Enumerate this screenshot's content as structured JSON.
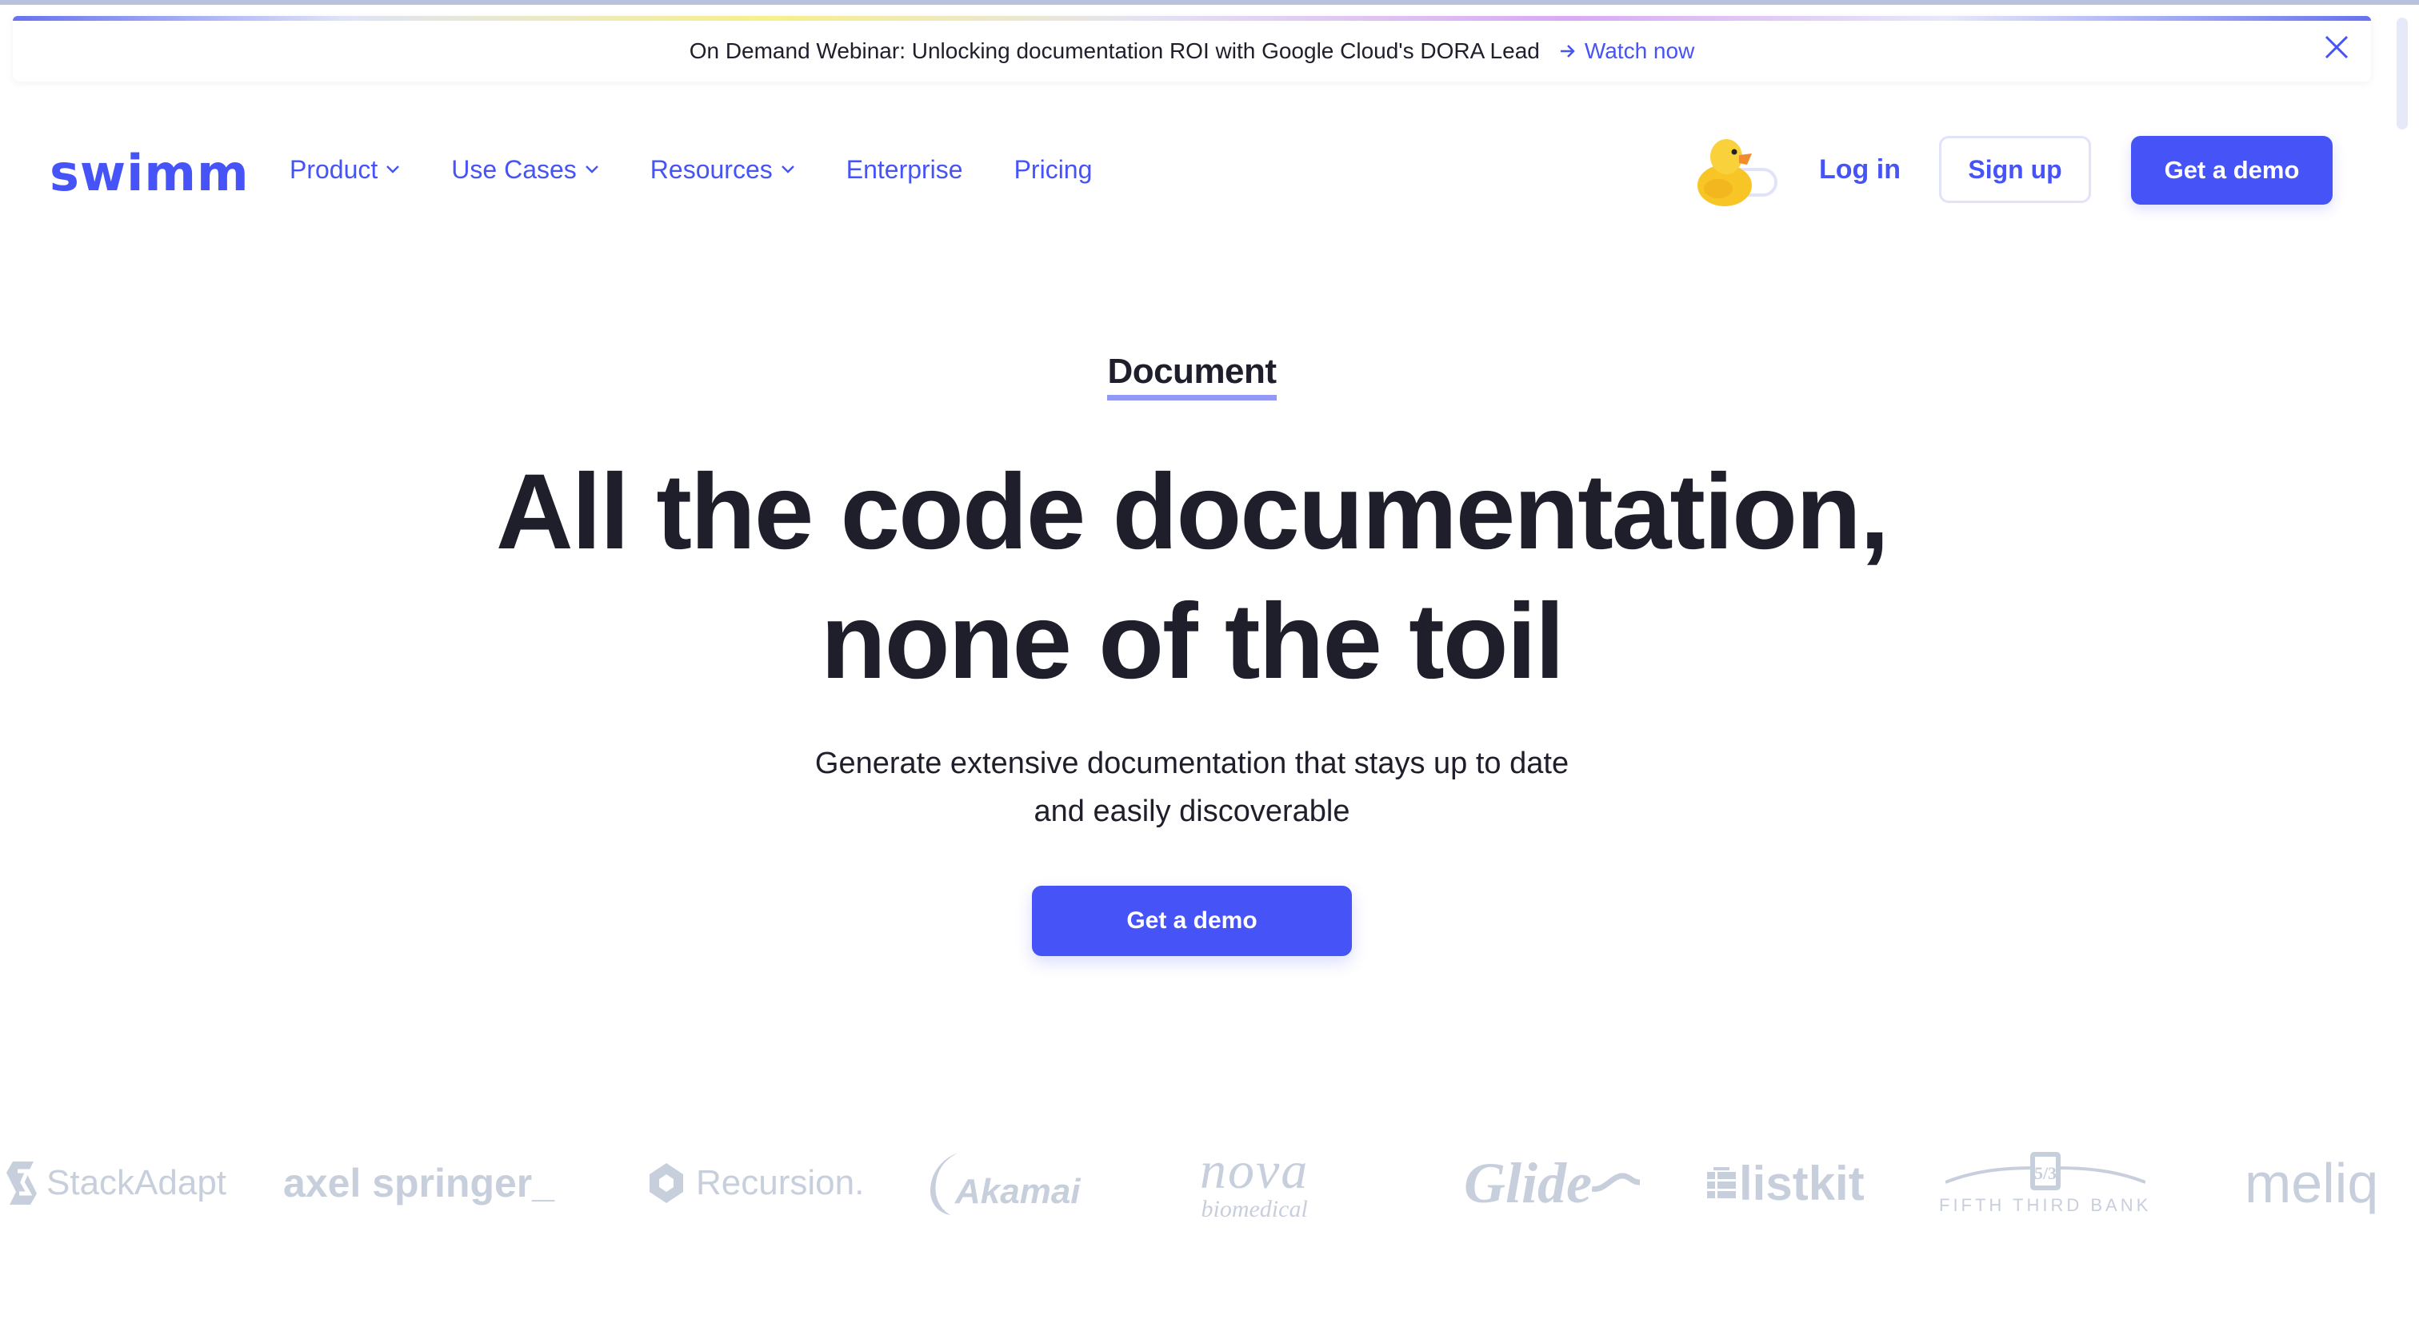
{
  "banner": {
    "text": "On Demand Webinar: Unlocking documentation ROI with Google Cloud's DORA Lead",
    "link_label": "Watch now",
    "close_icon": "close-icon",
    "arrow_icon": "arrow-right-icon"
  },
  "nav": {
    "logo": "swimm",
    "items": [
      {
        "label": "Product",
        "has_dropdown": true
      },
      {
        "label": "Use Cases",
        "has_dropdown": true
      },
      {
        "label": "Resources",
        "has_dropdown": true
      },
      {
        "label": "Enterprise",
        "has_dropdown": false
      },
      {
        "label": "Pricing",
        "has_dropdown": false
      }
    ],
    "mascot_icon": "rubber-duck-toggle-icon",
    "login_label": "Log in",
    "signup_label": "Sign up",
    "demo_label": "Get a demo"
  },
  "hero": {
    "eyebrow": "Document",
    "headline_line1": "All the code documentation,",
    "headline_line2": "none of the toil",
    "subtitle_line1": "Generate extensive documentation that stays up to date",
    "subtitle_line2": "and easily discoverable",
    "cta_label": "Get a demo"
  },
  "customer_logos": [
    "StackAdapt",
    "axel springer_",
    "Recursion.",
    "Akamai",
    "nova biomedical",
    "Glide",
    "listkit",
    "FIFTH THIRD BANK",
    "meliq"
  ],
  "colors": {
    "accent": "#4653f6",
    "text": "#1e1f2b",
    "logo_gray": "#c8cfdc",
    "eyebrow_underline": "#9299f5"
  }
}
